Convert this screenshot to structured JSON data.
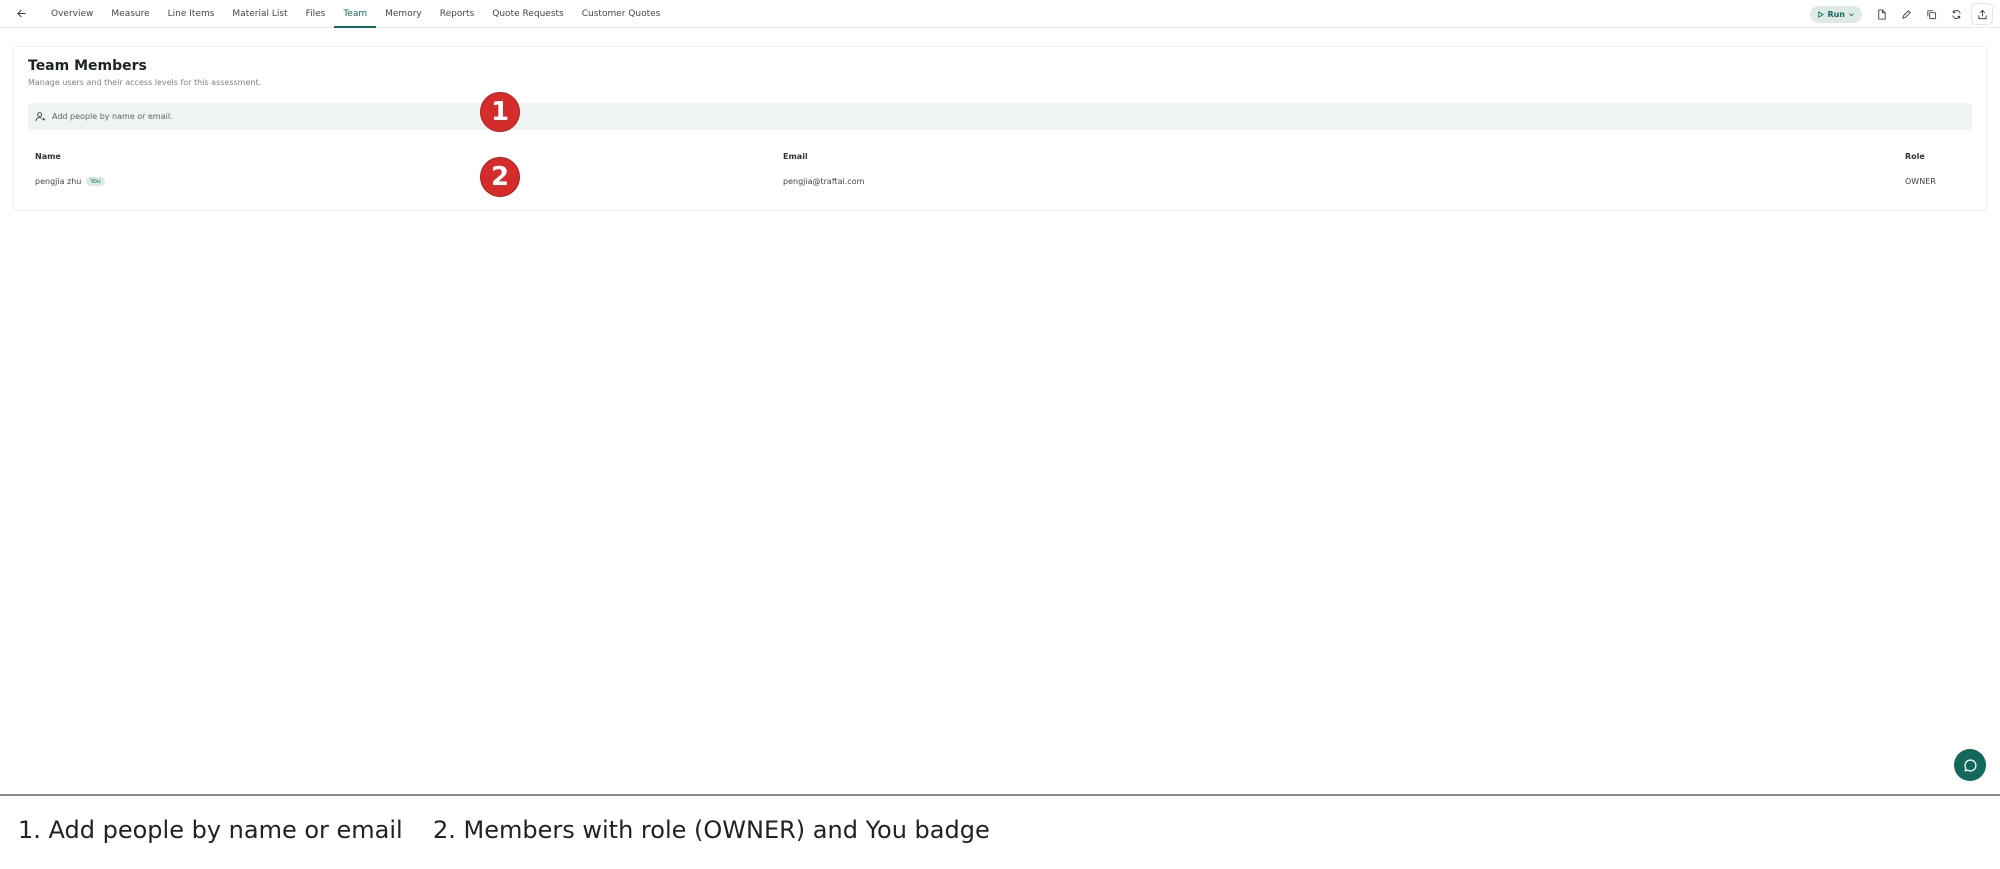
{
  "nav": {
    "tabs": [
      {
        "label": "Overview"
      },
      {
        "label": "Measure"
      },
      {
        "label": "Line Items"
      },
      {
        "label": "Material List"
      },
      {
        "label": "Files"
      },
      {
        "label": "Team"
      },
      {
        "label": "Memory"
      },
      {
        "label": "Reports"
      },
      {
        "label": "Quote Requests"
      },
      {
        "label": "Customer Quotes"
      }
    ],
    "active_tab": "Team"
  },
  "toolbar": {
    "run_label": "Run",
    "icons": [
      "document-icon",
      "edit-icon",
      "copy-icon",
      "refresh-icon",
      "export-icon"
    ]
  },
  "team": {
    "title": "Team Members",
    "subtitle": "Manage users and their access levels for this assessment.",
    "add_placeholder": "Add people by name or email.",
    "columns": {
      "name": "Name",
      "email": "Email",
      "role": "Role"
    },
    "members": [
      {
        "name": "pengjia zhu",
        "badge": "You",
        "email": "pengjia@traftai.com",
        "role": "OWNER"
      }
    ]
  },
  "annotations": {
    "markers": [
      "1",
      "2"
    ],
    "captions": [
      "1. Add people by name or email",
      "2. Members with role (OWNER) and You badge"
    ]
  },
  "colors": {
    "accent": "#14695e",
    "marker": "#d52b2b",
    "add_bar_bg": "#eff4f2"
  }
}
